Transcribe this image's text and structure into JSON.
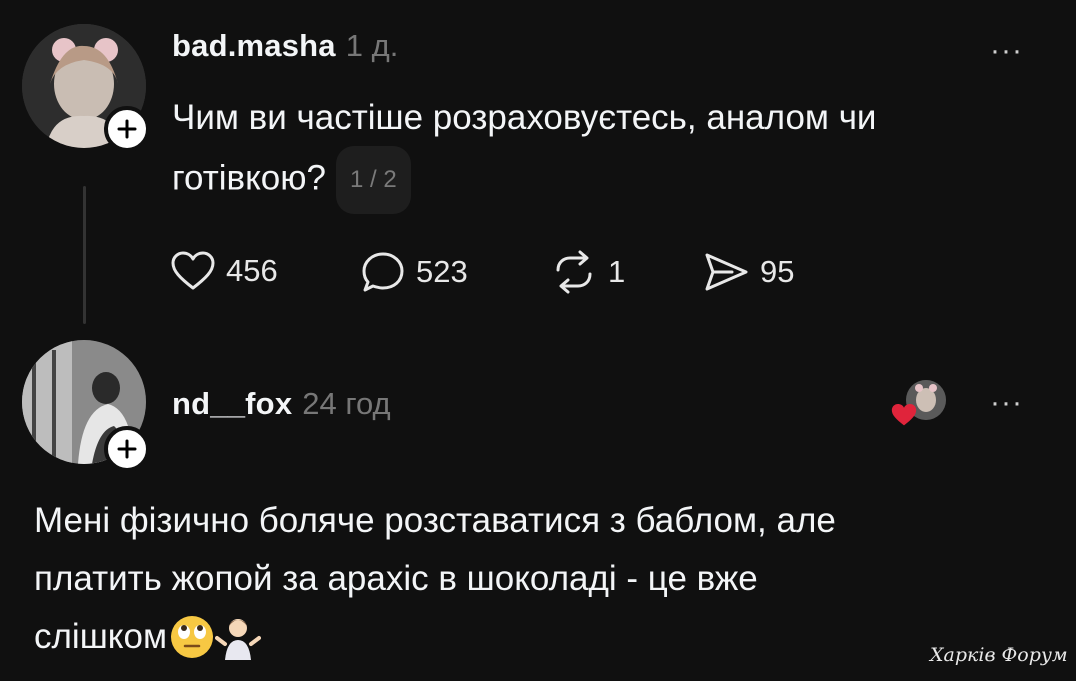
{
  "post": {
    "username": "bad.masha",
    "time": "1 д.",
    "text_line1": "Чим ви частіше розраховуєтесь, аналом чи",
    "text_line2": "готівкою?",
    "page_indicator": "1 / 2",
    "actions": {
      "likes": "456",
      "replies": "523",
      "reposts": "1",
      "shares": "95"
    }
  },
  "reply": {
    "username": "nd__fox",
    "time": "24 год",
    "text_line1": "Мені фізично боляче розставатися з баблом, але",
    "text_line2": "платить жопой за арахіс в шоколаді - це вже",
    "text_line3": "слішком",
    "emojis": [
      "face-with-rolling-eyes",
      "person-shrugging"
    ]
  },
  "more_label": "···",
  "watermark": "Харків Форум",
  "colors": {
    "background": "#101010",
    "text": "#f3f5f7",
    "muted": "#777777",
    "like_heart": "#e0243b"
  }
}
